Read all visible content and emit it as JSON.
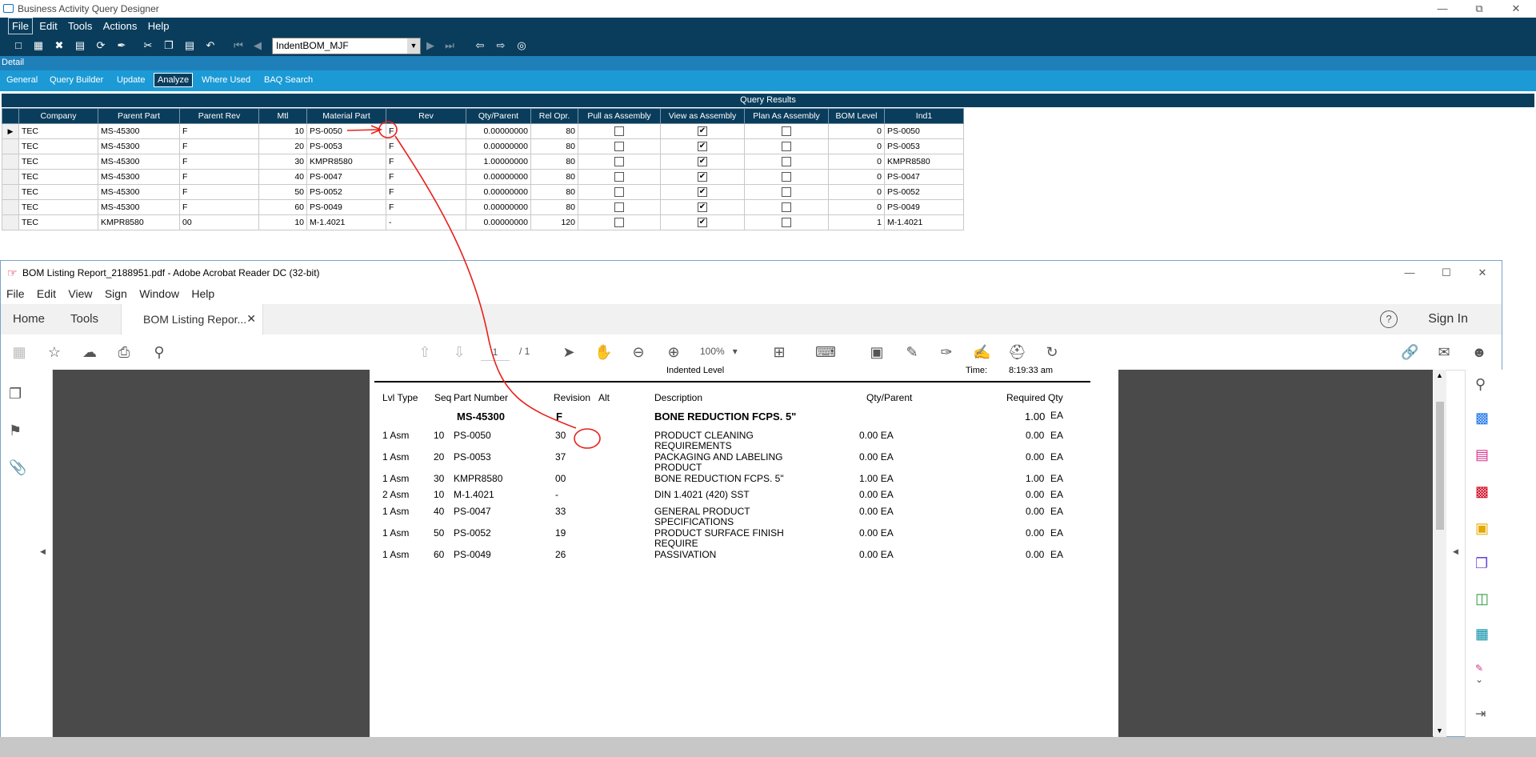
{
  "baq": {
    "title": "Business Activity Query Designer",
    "menu": [
      "File",
      "Edit",
      "Tools",
      "Actions",
      "Help"
    ],
    "query_name": "IndentBOM_MJF",
    "detail_label": "Detail",
    "tabs": [
      "General",
      "Query Builder",
      "Update",
      "Analyze",
      "Where Used",
      "BAQ Search"
    ],
    "active_tab": "Analyze",
    "results_title": "Query Results",
    "columns": [
      "Company",
      "Parent Part",
      "Parent Rev",
      "Mtl",
      "Material Part",
      "Rev",
      "Qty/Parent",
      "Rel Opr.",
      "Pull as Assembly",
      "View as Assembly",
      "Plan As Assembly",
      "BOM Level",
      "Ind1"
    ],
    "rows": [
      [
        "TEC",
        "MS-45300",
        "F",
        "10",
        "PS-0050",
        "F",
        "0.00000000",
        "80",
        false,
        true,
        false,
        "0",
        "PS-0050"
      ],
      [
        "TEC",
        "MS-45300",
        "F",
        "20",
        "PS-0053",
        "F",
        "0.00000000",
        "80",
        false,
        true,
        false,
        "0",
        "PS-0053"
      ],
      [
        "TEC",
        "MS-45300",
        "F",
        "30",
        "KMPR8580",
        "F",
        "1.00000000",
        "80",
        false,
        true,
        false,
        "0",
        "KMPR8580"
      ],
      [
        "TEC",
        "MS-45300",
        "F",
        "40",
        "PS-0047",
        "F",
        "0.00000000",
        "80",
        false,
        true,
        false,
        "0",
        "PS-0047"
      ],
      [
        "TEC",
        "MS-45300",
        "F",
        "50",
        "PS-0052",
        "F",
        "0.00000000",
        "80",
        false,
        true,
        false,
        "0",
        "PS-0052"
      ],
      [
        "TEC",
        "MS-45300",
        "F",
        "60",
        "PS-0049",
        "F",
        "0.00000000",
        "80",
        false,
        true,
        false,
        "0",
        "PS-0049"
      ],
      [
        "TEC",
        "KMPR8580",
        "00",
        "10",
        "M-1.4021",
        "-",
        "0.00000000",
        "120",
        false,
        true,
        false,
        "1",
        "M-1.4021"
      ]
    ]
  },
  "acrobat": {
    "title": "BOM Listing Report_2188951.pdf - Adobe Acrobat Reader DC (32-bit)",
    "menu": [
      "File",
      "Edit",
      "View",
      "Sign",
      "Window",
      "Help"
    ],
    "home_tab": "Home",
    "tools_tab": "Tools",
    "doc_tab": "BOM Listing Repor...",
    "sign_in": "Sign In",
    "page_current": "1",
    "page_total": "/ 1",
    "zoom": "100%",
    "report": {
      "partial_header_left": "Indented Level",
      "partial_header_right_label": "Time:",
      "partial_header_right_value": "8:19:33 am",
      "headers": {
        "lvl": "Lvl Type",
        "seq": "Seq",
        "part": "Part Number",
        "rev": "Revision",
        "alt": "Alt",
        "desc": "Description",
        "qty": "Qty/Parent",
        "req": "Required Qty"
      },
      "parent": {
        "part": "MS-45300",
        "rev": "F",
        "desc": "BONE REDUCTION FCPS. 5\"",
        "req": "1.00",
        "uom": "EA"
      },
      "lines": [
        {
          "lvl": "1 Asm",
          "seq": "10",
          "part": "PS-0050",
          "rev": "30",
          "desc1": "PRODUCT CLEANING",
          "desc2": "REQUIREMENTS",
          "qty": "0.00 EA",
          "req": "0.00",
          "uom": "EA"
        },
        {
          "lvl": "1 Asm",
          "seq": "20",
          "part": "PS-0053",
          "rev": "37",
          "desc1": "PACKAGING AND LABELING",
          "desc2": "PRODUCT",
          "qty": "0.00 EA",
          "req": "0.00",
          "uom": "EA"
        },
        {
          "lvl": "1 Asm",
          "seq": "30",
          "part": "KMPR8580",
          "rev": "00",
          "desc1": "BONE REDUCTION FCPS. 5\"",
          "desc2": "",
          "qty": "1.00 EA",
          "req": "1.00",
          "uom": "EA"
        },
        {
          "lvl": "2 Asm",
          "seq": "10",
          "part": "M-1.4021",
          "rev": "-",
          "desc1": "DIN 1.4021 (420) SST",
          "desc2": "",
          "qty": "0.00 EA",
          "req": "0.00",
          "uom": "EA"
        },
        {
          "lvl": "1 Asm",
          "seq": "40",
          "part": "PS-0047",
          "rev": "33",
          "desc1": "GENERAL PRODUCT",
          "desc2": "SPECIFICATIONS",
          "qty": "0.00 EA",
          "req": "0.00",
          "uom": "EA"
        },
        {
          "lvl": "1 Asm",
          "seq": "50",
          "part": "PS-0052",
          "rev": "19",
          "desc1": "PRODUCT SURFACE FINISH",
          "desc2": "REQUIRE",
          "qty": "0.00 EA",
          "req": "0.00",
          "uom": "EA"
        },
        {
          "lvl": "1 Asm",
          "seq": "60",
          "part": "PS-0049",
          "rev": "26",
          "desc1": "PASSIVATION",
          "desc2": "",
          "qty": "0.00 EA",
          "req": "0.00",
          "uom": "EA"
        }
      ]
    }
  },
  "annotation_color": "#e8201a"
}
